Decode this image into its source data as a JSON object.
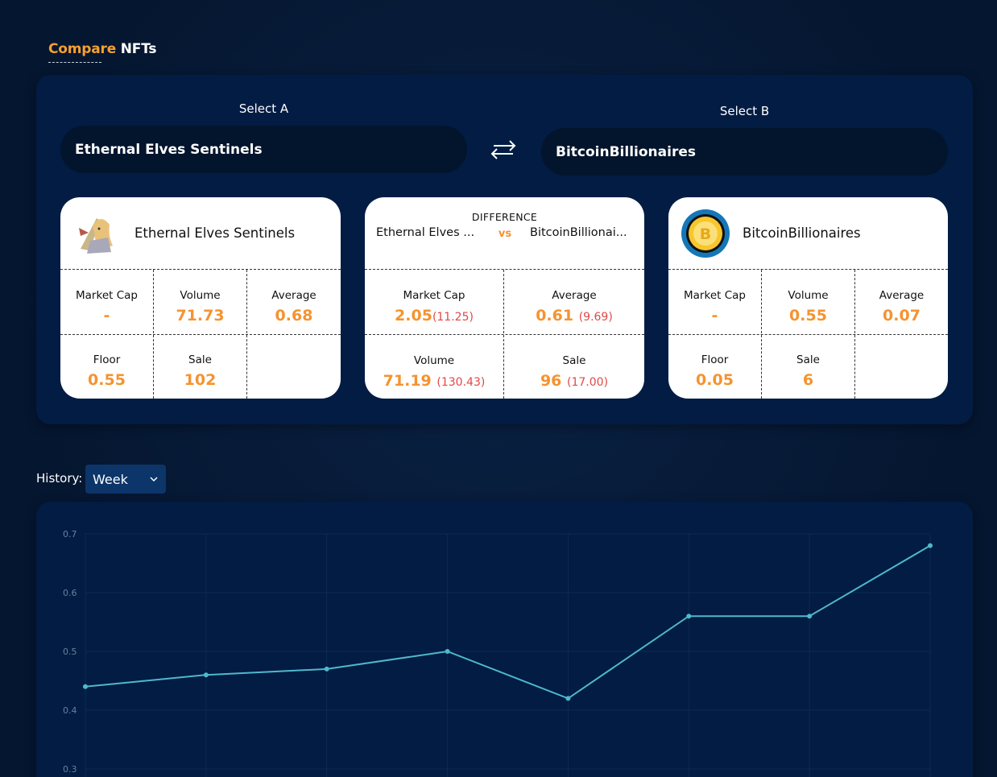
{
  "header": {
    "title_accent": "Compare",
    "title_rest": "NFTs"
  },
  "select_a": {
    "label": "Select A",
    "value": "Ethernal Elves Sentinels"
  },
  "select_b": {
    "label": "Select B",
    "value": "BitcoinBillionaires"
  },
  "card_a": {
    "name": "Ethernal Elves Sentinels",
    "market_cap_label": "Market Cap",
    "market_cap": "-",
    "volume_label": "Volume",
    "volume": "71.73",
    "average_label": "Average",
    "average": "0.68",
    "floor_label": "Floor",
    "floor": "0.55",
    "sale_label": "Sale",
    "sale": "102"
  },
  "difference": {
    "caption": "DIFFERENCE",
    "left_name": "Ethernal Elves ...",
    "vs": "vs",
    "right_name": "BitcoinBillionai...",
    "market_cap_label": "Market Cap",
    "market_cap": "2.05",
    "market_cap_pct": "(11.25)",
    "average_label": "Average",
    "average": "0.61",
    "average_pct": "(9.69)",
    "volume_label": "Volume",
    "volume": "71.19",
    "volume_pct": "(130.43)",
    "sale_label": "Sale",
    "sale": "96",
    "sale_pct": "(17.00)"
  },
  "card_b": {
    "name": "BitcoinBillionaires",
    "market_cap_label": "Market Cap",
    "market_cap": "-",
    "volume_label": "Volume",
    "volume": "0.55",
    "average_label": "Average",
    "average": "0.07",
    "floor_label": "Floor",
    "floor": "0.05",
    "sale_label": "Sale",
    "sale": "6"
  },
  "history": {
    "label": "History:",
    "selected": "Week"
  },
  "colors": {
    "accent": "#f59330",
    "line": "#4fb8cc",
    "negative": "#e24848",
    "panel": "#021c44"
  },
  "chart_data": {
    "type": "line",
    "title": "",
    "xlabel": "",
    "ylabel": "",
    "ylim": [
      0.3,
      0.7
    ],
    "y_ticks": [
      0.7,
      0.6,
      0.5,
      0.4,
      0.3
    ],
    "grid": true,
    "series": [
      {
        "values": [
          0.44,
          0.46,
          0.47,
          0.5,
          0.42,
          0.56,
          0.56,
          0.68
        ]
      }
    ]
  }
}
